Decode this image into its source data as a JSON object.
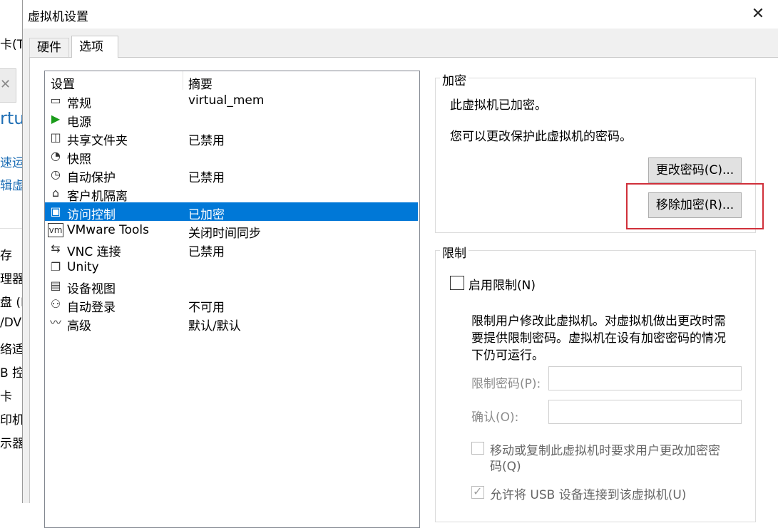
{
  "background_window": {
    "lines": [
      "卡(T)",
      "rtu",
      "速运行",
      "辑虚拟",
      "存",
      "理器",
      "盘 (N",
      "/DV",
      "络适配",
      "B 控",
      "卡",
      "印机",
      "示器"
    ]
  },
  "dialog": {
    "title": "虚拟机设置",
    "close_glyph": "✕",
    "tabs": [
      {
        "label": "硬件",
        "active": false
      },
      {
        "label": "选项",
        "active": true
      }
    ]
  },
  "settings_list": {
    "header": {
      "setting": "设置",
      "summary": "摘要"
    },
    "items": [
      {
        "label": "常规",
        "summary": "virtual_mem",
        "icon": "monitor-icon",
        "glyph": "▭"
      },
      {
        "label": "电源",
        "summary": "",
        "icon": "power-play-icon",
        "glyph": "▶"
      },
      {
        "label": "共享文件夹",
        "summary": "已禁用",
        "icon": "shared-folder-icon",
        "glyph": "◫"
      },
      {
        "label": "快照",
        "summary": "",
        "icon": "snapshot-icon",
        "glyph": "◔"
      },
      {
        "label": "自动保护",
        "summary": "已禁用",
        "icon": "clock-icon",
        "glyph": "◷"
      },
      {
        "label": "客户机隔离",
        "summary": "",
        "icon": "lock-icon",
        "glyph": "⌂"
      },
      {
        "label": "访问控制",
        "summary": "已加密",
        "icon": "access-control-icon",
        "glyph": "▣"
      },
      {
        "label": "VMware Tools",
        "summary": "关闭时间同步",
        "icon": "vm-icon",
        "glyph": "vm"
      },
      {
        "label": "VNC 连接",
        "summary": "已禁用",
        "icon": "vnc-icon",
        "glyph": "⇆"
      },
      {
        "label": "Unity",
        "summary": "",
        "icon": "unity-icon",
        "glyph": "❐"
      },
      {
        "label": "设备视图",
        "summary": "",
        "icon": "device-view-icon",
        "glyph": "▤"
      },
      {
        "label": "自动登录",
        "summary": "不可用",
        "icon": "user-login-icon",
        "glyph": "⚇"
      },
      {
        "label": "高级",
        "summary": "默认/默认",
        "icon": "advanced-icon",
        "glyph": "〰"
      }
    ],
    "selected_index": 6
  },
  "encryption": {
    "title": "加密",
    "status": "此虚拟机已加密。",
    "hint": "您可以更改保护此虚拟机的密码。",
    "change_password_button": "更改密码(C)...",
    "remove_encryption_button": "移除加密(R)..."
  },
  "restrictions": {
    "title": "限制",
    "enable_checkbox": {
      "label": "启用限制(N)",
      "checked": false
    },
    "description_lines": [
      "限制用户修改此虚拟机。对虚拟机做出更改时需",
      "要提供限制密码。虚拟机在设有加密密码的情况",
      "下仍可运行。"
    ],
    "password_label": "限制密码(P):",
    "confirm_label": "确认(O):",
    "require_change_checkbox": {
      "label_lines": [
        "移动或复制此虚拟机时要求用户更改加密密",
        "码(Q)"
      ],
      "checked": false
    },
    "allow_usb_checkbox": {
      "label": "允许将 USB 设备连接到该虚拟机(U)",
      "checked": true
    }
  },
  "colors": {
    "selection": "#0078d7",
    "highlight_border": "#d0303a",
    "power_icon": "#1a9c1a"
  }
}
